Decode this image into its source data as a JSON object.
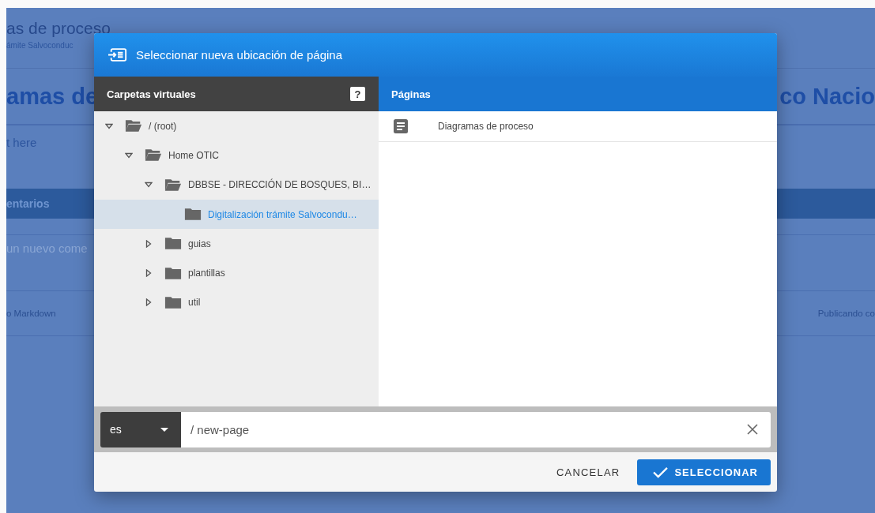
{
  "background_page": {
    "title_fragment": "as de proceso",
    "subtitle_fragment": "ámite Salvoconduc",
    "heading_left": "amas de",
    "heading_right": "co Nacio",
    "body_fragment": "t here",
    "comments_header": "entarios",
    "comment_placeholder": "un nuevo come",
    "footer_left": "o Markdown",
    "footer_right": "Publicando co"
  },
  "dialog": {
    "title": "Seleccionar nueva ubicación de página",
    "folders_header": "Carpetas virtuales",
    "help_label": "?",
    "tree": [
      {
        "label": "/ (root)",
        "expanded": true,
        "selected": false,
        "children": [
          {
            "label": "Home OTIC",
            "expanded": true,
            "selected": false,
            "children": [
              {
                "label": "DBBSE - DIRECCIÓN DE BOSQUES, BI…",
                "expanded": true,
                "selected": false,
                "children": [
                  {
                    "label": "Digitalización trámite Salvocondu…",
                    "selected": true
                  }
                ]
              },
              {
                "label": "guias",
                "expanded": false,
                "selected": false
              },
              {
                "label": "plantillas",
                "expanded": false,
                "selected": false
              },
              {
                "label": "util",
                "expanded": false,
                "selected": false
              }
            ]
          }
        ]
      }
    ],
    "pages_header": "Páginas",
    "pages": [
      {
        "title": "Diagramas de proceso"
      }
    ],
    "locale": "es",
    "path": "/ new-page",
    "cancel": "CANCELAR",
    "confirm": "SELECCIONAR"
  }
}
